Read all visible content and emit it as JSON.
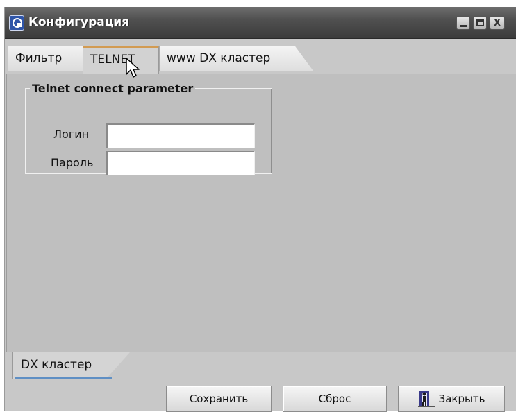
{
  "window": {
    "title": "Конфигурация",
    "controls": {
      "minimize": "_",
      "close": "X"
    }
  },
  "tabs": [
    {
      "label": "Фильтр",
      "active": false
    },
    {
      "label": "TELNET",
      "active": true
    },
    {
      "label": "www DX кластер",
      "active": false
    }
  ],
  "telnet": {
    "group_title": "Telnet connect parameter",
    "login_label": "Логин",
    "login_value": "",
    "password_label": "Пароль",
    "password_value": ""
  },
  "bottom_tab": {
    "label": "DX кластер"
  },
  "buttons": {
    "save": "Сохранить",
    "reset": "Сброс",
    "close": "Закрыть"
  },
  "colors": {
    "titlebar": "#4a4a4a",
    "panel": "#bfbfbf",
    "active_tab_accent": "#d29b52",
    "bottom_tab_accent": "#5f8fc4"
  }
}
